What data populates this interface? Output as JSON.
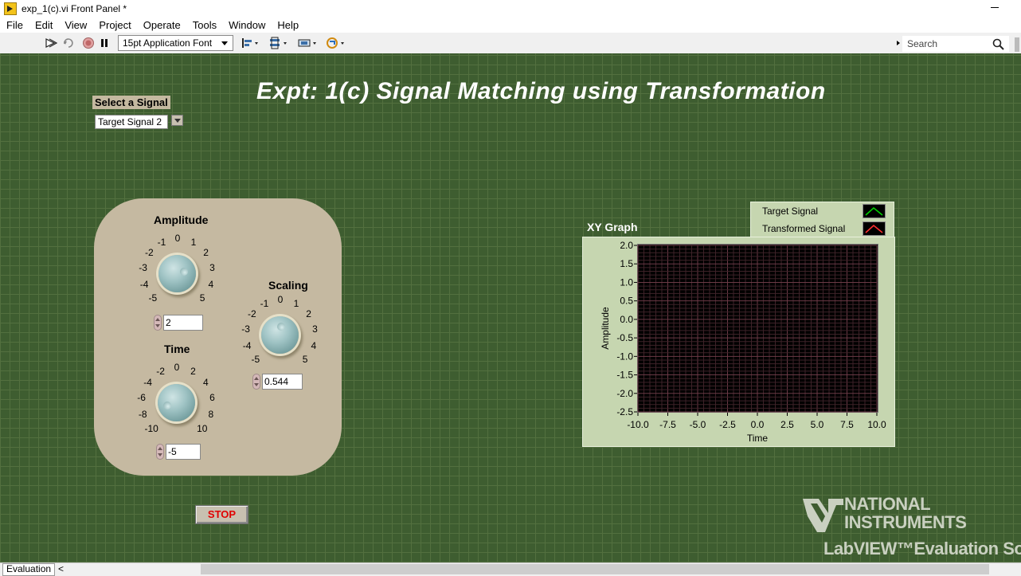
{
  "window": {
    "title": "exp_1(c).vi Front Panel *"
  },
  "menu": [
    "File",
    "Edit",
    "View",
    "Project",
    "Operate",
    "Tools",
    "Window",
    "Help"
  ],
  "toolbar": {
    "font_select": "15pt Application Font",
    "search_placeholder": "Search",
    "icons": [
      "run-arrow-icon",
      "run-continuously-icon",
      "abort-icon",
      "pause-icon",
      "align-icon",
      "distribute-icon",
      "resize-icon",
      "reorder-icon"
    ]
  },
  "panel": {
    "title": "Expt: 1(c) Signal Matching using Transformation",
    "select_signal": {
      "label": "Select a Signal",
      "value": "Target Signal 2"
    },
    "amplitude": {
      "label": "Amplitude",
      "value": "2",
      "ticks": [
        "-5",
        "-4",
        "-3",
        "-2",
        "-1",
        "0",
        "1",
        "2",
        "3",
        "4",
        "5"
      ]
    },
    "time": {
      "label": "Time",
      "value": "-5",
      "ticks": [
        "-10",
        "-8",
        "-6",
        "-4",
        "-2",
        "0",
        "2",
        "4",
        "6",
        "8",
        "10"
      ]
    },
    "scaling": {
      "label": "Scaling",
      "value": "0.544",
      "ticks": [
        "-5",
        "-4",
        "-3",
        "-2",
        "-1",
        "0",
        "1",
        "2",
        "3",
        "4",
        "5"
      ]
    },
    "stop_label": "STOP"
  },
  "graph": {
    "title": "XY Graph",
    "legend": [
      {
        "name": "Target Signal",
        "color": "#00d000"
      },
      {
        "name": "Transformed  Signal",
        "color": "#ff3030"
      }
    ]
  },
  "chart_data": {
    "type": "scatter",
    "title": "XY Graph",
    "xlabel": "Time",
    "ylabel": "Amplitude",
    "xlim": [
      -10,
      10
    ],
    "ylim": [
      -2.5,
      2
    ],
    "x_ticks": [
      "-10.0",
      "-7.5",
      "-5.0",
      "-2.5",
      "0.0",
      "2.5",
      "5.0",
      "7.5",
      "10.0"
    ],
    "y_ticks": [
      "2.0",
      "1.5",
      "1.0",
      "0.5",
      "0.0",
      "-0.5",
      "-1.0",
      "-1.5",
      "-2.0",
      "-2.5"
    ],
    "grid": true,
    "series": [
      {
        "name": "Target Signal",
        "x": [],
        "y": [],
        "color": "#00d000"
      },
      {
        "name": "Transformed  Signal",
        "x": [],
        "y": [],
        "color": "#ff3030"
      }
    ]
  },
  "watermark": {
    "line1": "NATIONAL",
    "line2": "INSTRUMENTS",
    "line3": "LabVIEW™Evaluation Soft"
  },
  "statusbar": {
    "tab": "Evaluation"
  }
}
